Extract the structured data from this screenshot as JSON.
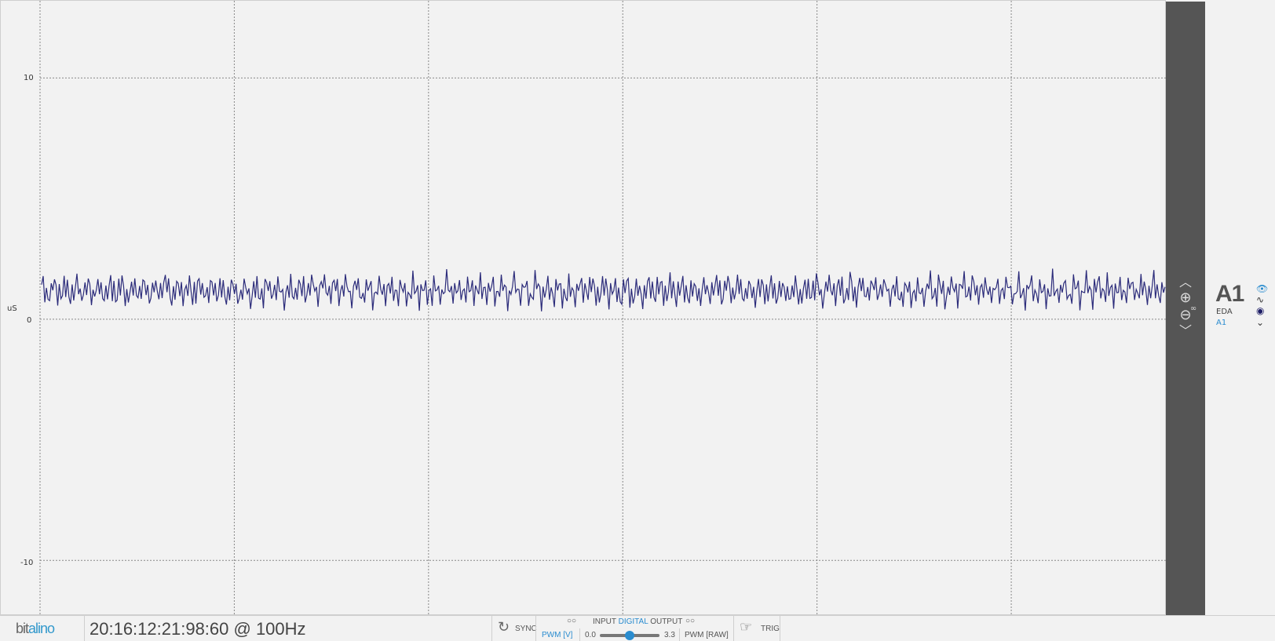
{
  "plot": {
    "y_unit": "uS",
    "y_ticks": [
      "10",
      "0",
      "-10"
    ],
    "line_color": "#2b2b7a",
    "signal_mean": 1.2,
    "signal_amplitude": 0.8,
    "y_range": [
      -12.3,
      13.2
    ],
    "samples": 700
  },
  "channel": {
    "name": "A1",
    "sensor": "EDA",
    "port": "A1",
    "icons": [
      "eye-icon",
      "waveform-icon",
      "record-dot-icon",
      "chevron-down-icon"
    ]
  },
  "zoom": {
    "icons": [
      "chevron-up-icon",
      "zoom-in-icon",
      "zoom-out-icon",
      "chevron-down-icon",
      "infinity-icon"
    ]
  },
  "status": {
    "logo_a": "bit",
    "logo_b": "alino",
    "device": "20:16:12:21:98:60 @ 100Hz",
    "sync": "SYNC",
    "io_input": "INPUT",
    "io_digital": "DIGITAL",
    "io_output": "OUTPUT",
    "pwm_v": "PWM [V]",
    "pwm_min": "0.0",
    "pwm_max": "3.3",
    "pwm_raw": "PWM [RAW]",
    "pwm_value_fraction": 0.5,
    "trig": "TRIG",
    "accent": "#2a8ccf"
  }
}
